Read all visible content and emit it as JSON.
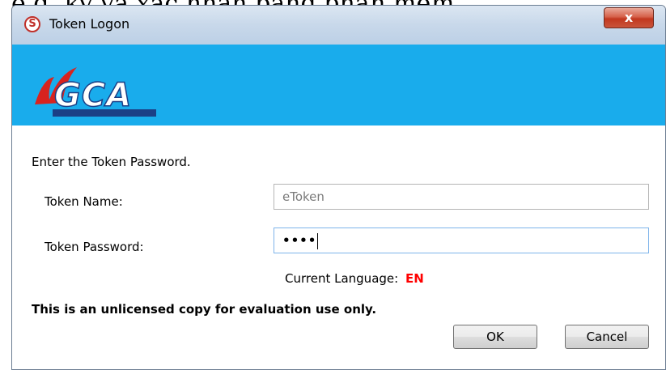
{
  "window": {
    "title": "Token Logon",
    "app_icon_letter": "S",
    "close_glyph": "x"
  },
  "banner": {
    "color": "#19acec",
    "logo_text": "VGCA"
  },
  "form": {
    "prompt": "Enter the Token Password.",
    "token_name_label": "Token Name:",
    "token_name_value": "eToken",
    "token_password_label": "Token Password:",
    "token_password_value": "••••",
    "current_language_label": "Current Language:",
    "current_language_value": "EN",
    "notice": "This is an unlicensed copy for evaluation use only."
  },
  "buttons": {
    "ok": "OK",
    "cancel": "Cancel"
  },
  "background": {
    "caption": "e.g. ký và xác nhận bằng phần mềm"
  }
}
